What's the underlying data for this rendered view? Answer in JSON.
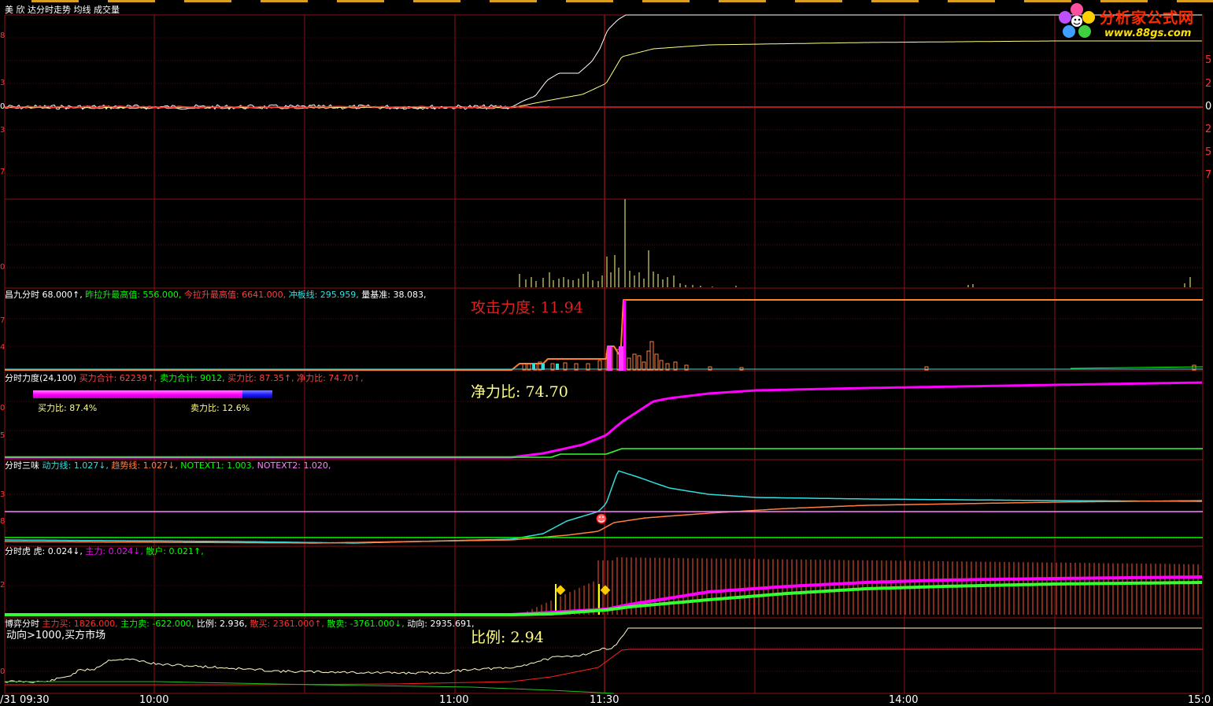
{
  "colors": {
    "grid": "#8b1010",
    "price": "#ffffff",
    "avg": "#ffff80",
    "red": "#ff3030",
    "green": "#00ff00",
    "magenta": "#ff00ff",
    "cyan": "#33dddd",
    "orange": "#ff8040",
    "yellow": "#ffff00"
  },
  "logo": {
    "icon": "flower-logo-icon",
    "title": "分析家公式网",
    "url": "www.88gs.com"
  },
  "panel_main": {
    "title_items": [
      "美 欣",
      "达分时走势",
      "均线",
      "成交量"
    ],
    "right_axis": [
      "5",
      "2",
      "0",
      "2",
      "5",
      "7"
    ],
    "left_axis": [
      "8",
      "3",
      "0",
      "3",
      "7"
    ]
  },
  "panel_volume": {
    "left_axis": [
      "0"
    ]
  },
  "panel_cj": {
    "header": [
      {
        "text": "昌九分时",
        "color": "#ffffff"
      },
      {
        "text": " 68.000↑,",
        "color": "#ffffff"
      },
      {
        "text": " 昨拉升最高值: 556.000,",
        "color": "#00ff00"
      },
      {
        "text": " 今拉升最高值: 6641.000,",
        "color": "#ff4040"
      },
      {
        "text": " 冲板线: 295.959,",
        "color": "#33dddd"
      },
      {
        "text": " 量基准: 38.083,",
        "color": "#ffffff"
      }
    ],
    "big_label": "攻击力度: 11.94",
    "left_axis": [
      "7",
      "4"
    ]
  },
  "panel_force": {
    "header": [
      {
        "text": "分时力度(24,100)",
        "color": "#ffffff"
      },
      {
        "text": " 买力合计: 62239↑,",
        "color": "#ff4040"
      },
      {
        "text": " 卖力合计: 9012,",
        "color": "#00ff00"
      },
      {
        "text": " 买力比: 87.35↑,",
        "color": "#ff4040"
      },
      {
        "text": " 净力比: 74.70↑,",
        "color": "#ff4040"
      }
    ],
    "buy_label": "买力比: 87.4%",
    "sell_label": "卖力比: 12.6%",
    "buy_ratio": 0.874,
    "big_label": "净力比: 74.70",
    "left_axis": [
      "0",
      "5"
    ]
  },
  "panel_three": {
    "header": [
      {
        "text": "分时三味",
        "color": "#ffffff"
      },
      {
        "text": " 动力线: 1.027↓,",
        "color": "#33dddd"
      },
      {
        "text": " 趋势线: 1.027↓,",
        "color": "#ff8040"
      },
      {
        "text": " NOTEXT1: 1.003,",
        "color": "#00ff00"
      },
      {
        "text": " NOTEXT2: 1.020,",
        "color": "#ff80ff"
      }
    ],
    "left_axis": [
      "3",
      "8"
    ],
    "smiley_icon": "smiley-icon"
  },
  "panel_tiger": {
    "header": [
      {
        "text": "分时虎",
        "color": "#ffffff"
      },
      {
        "text": " 虎: 0.024↓,",
        "color": "#ffffff"
      },
      {
        "text": " 主力: 0.024↓,",
        "color": "#ff00ff"
      },
      {
        "text": " 散户: 0.021↑,",
        "color": "#00ff00"
      }
    ],
    "left_axis": [
      "2"
    ]
  },
  "panel_game": {
    "header": [
      {
        "text": "博弈分时",
        "color": "#ffffff"
      },
      {
        "text": " 主力买: 1826.000,",
        "color": "#ff3030"
      },
      {
        "text": " 主力卖: -622.000,",
        "color": "#00ff00"
      },
      {
        "text": " 比例: 2.936,",
        "color": "#ffffff"
      },
      {
        "text": " 散买: 2361.000↑,",
        "color": "#ff3030"
      },
      {
        "text": " 散卖: -3761.000↓,",
        "color": "#00ff00"
      },
      {
        "text": " 动向: 2935.691,",
        "color": "#ffffff"
      }
    ],
    "status": "动向>1000,买方市场",
    "big_label": "比例: 2.94",
    "left_axis": [
      "0"
    ]
  },
  "x_axis": {
    "labels": [
      "/31 09:30",
      "10:00",
      "11:00",
      "11:30",
      "14:00",
      "15:0"
    ]
  }
}
